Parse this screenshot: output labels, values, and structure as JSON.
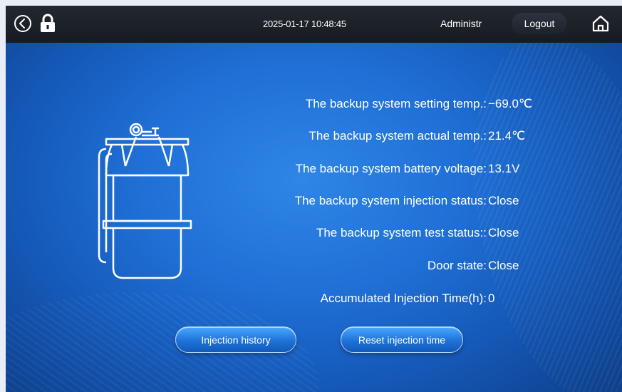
{
  "header": {
    "datetime": "2025-01-17 10:48:45",
    "user": "Administrat",
    "logout_label": "Logout"
  },
  "status": {
    "rows": [
      {
        "label": "The backup system setting temp.:",
        "value": "−69.0℃"
      },
      {
        "label": "The backup system actual temp.:",
        "value": "21.4℃"
      },
      {
        "label": "The backup system battery voltage:",
        "value": "13.1V"
      },
      {
        "label": "The backup system injection status:",
        "value": "Close"
      },
      {
        "label": "The backup system test status::",
        "value": "Close"
      },
      {
        "label": "Door state:",
        "value": "Close"
      },
      {
        "label": "Accumulated Injection Time(h):",
        "value": "0"
      }
    ]
  },
  "actions": {
    "history_label": "Injection history",
    "reset_label": "Reset injection time"
  },
  "icons": {
    "back": "back-arrow-icon",
    "lock": "lock-icon",
    "home": "home-icon",
    "tank": "gas-cylinder-icon"
  },
  "colors": {
    "topbar": "#1b2027",
    "background": "#1f6fd6",
    "button": "#1e72d8",
    "text": "#ffffff"
  }
}
